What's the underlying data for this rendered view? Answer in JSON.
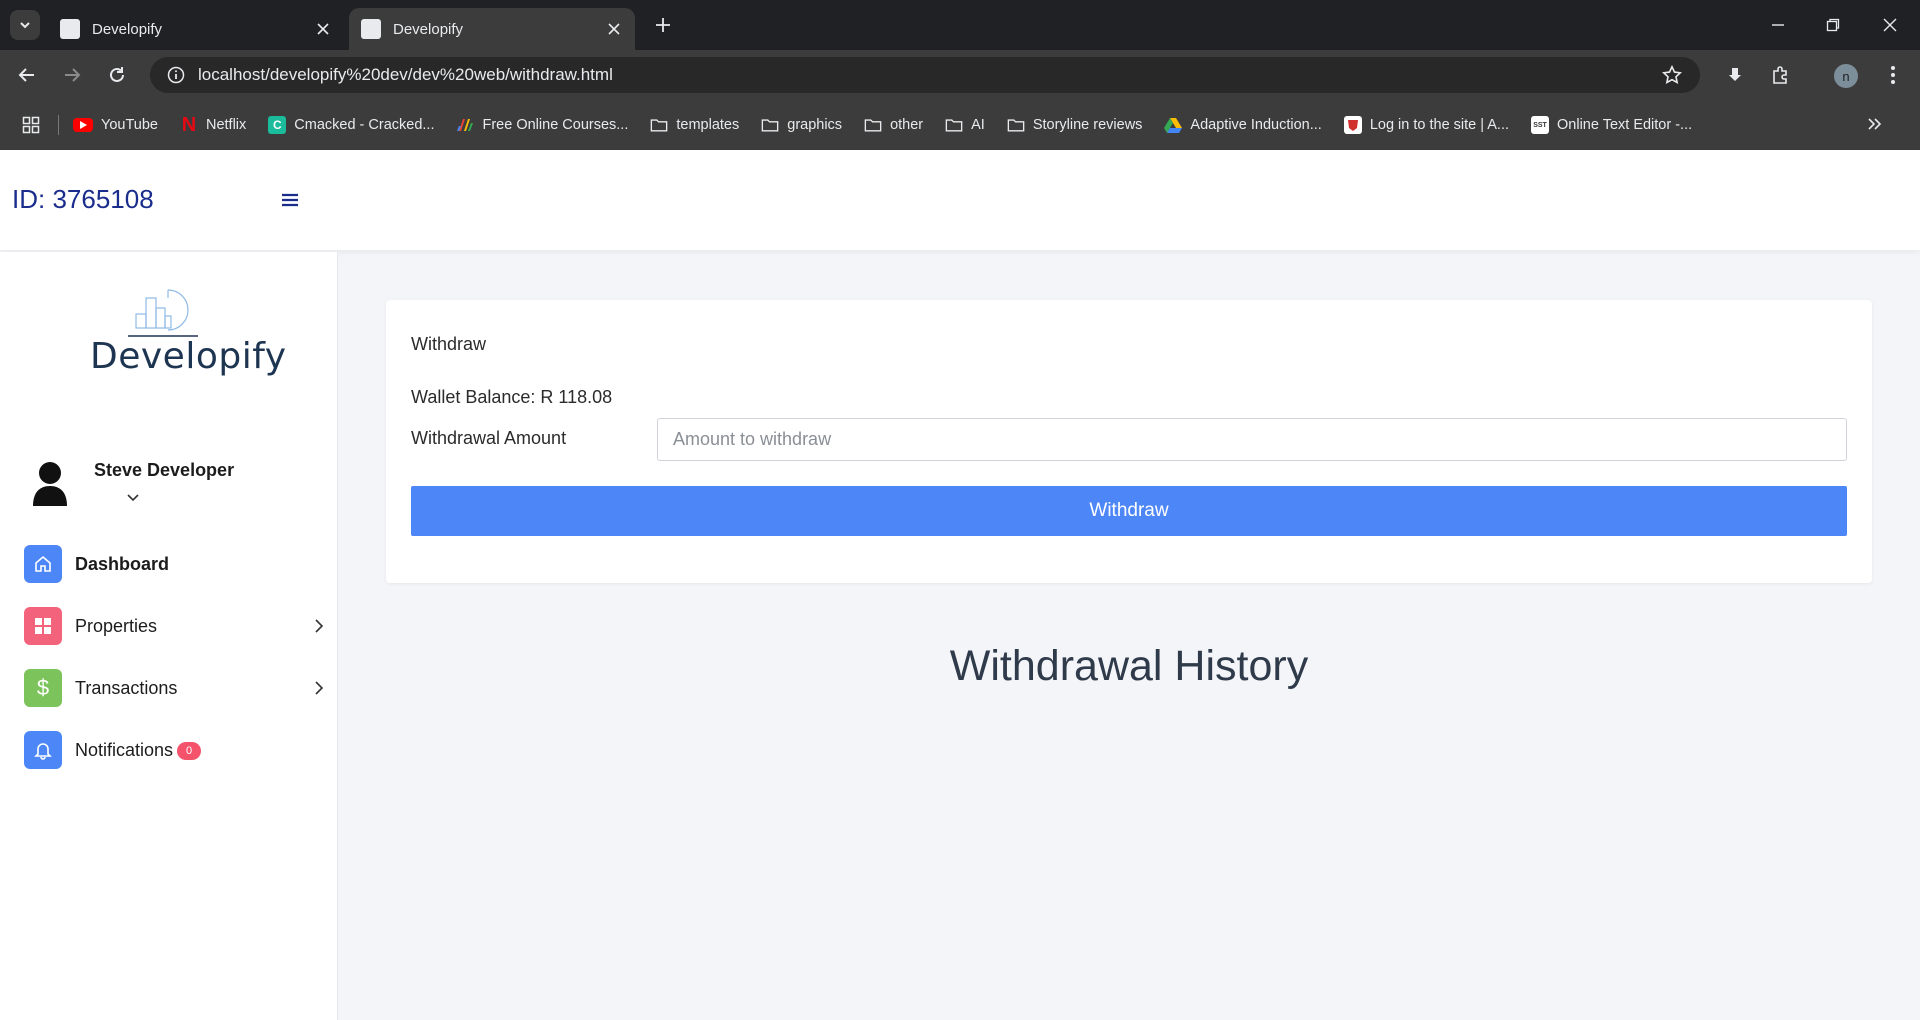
{
  "browser": {
    "tabs": [
      {
        "title": "Developify",
        "active": false
      },
      {
        "title": "Developify",
        "active": true
      }
    ],
    "url": "localhost/developify%20dev/dev%20web/withdraw.html",
    "profile_initial": "n",
    "bookmarks": [
      {
        "label": "YouTube",
        "icon": "youtube-icon",
        "color": "#ff0000"
      },
      {
        "label": "Netflix",
        "icon": "netflix-icon",
        "color": "#e50914"
      },
      {
        "label": "Cmacked - Cracked...",
        "icon": "cmacked-icon",
        "color": "#1abc9c"
      },
      {
        "label": "Free Online Courses...",
        "icon": "courses-icon",
        "color": "#4285f4"
      },
      {
        "label": "templates",
        "icon": "folder-icon"
      },
      {
        "label": "graphics",
        "icon": "folder-icon"
      },
      {
        "label": "other",
        "icon": "folder-icon"
      },
      {
        "label": "AI",
        "icon": "folder-icon"
      },
      {
        "label": "Storyline reviews",
        "icon": "folder-icon"
      },
      {
        "label": "Adaptive Induction...",
        "icon": "drive-icon"
      },
      {
        "label": "Log in to the site | A...",
        "icon": "moodle-icon"
      },
      {
        "label": "Online Text Editor -...",
        "icon": "sst-icon"
      }
    ]
  },
  "header": {
    "user_id": "ID: 3765108"
  },
  "sidebar": {
    "brand": "Developify",
    "user_name": "Steve Developer",
    "items": [
      {
        "label": "Dashboard",
        "color": "#4d87f7"
      },
      {
        "label": "Properties",
        "color": "#f4637c"
      },
      {
        "label": "Transactions",
        "color": "#7dc35b"
      },
      {
        "label": "Notifications",
        "color": "#4d87f7",
        "badge": "0"
      }
    ]
  },
  "withdraw_card": {
    "title": "Withdraw",
    "wallet_balance": "Wallet Balance: R 118.08",
    "amount_label": "Withdrawal Amount",
    "amount_placeholder": "Amount to withdraw",
    "button_label": "Withdraw"
  },
  "history": {
    "title": "Withdrawal History"
  }
}
